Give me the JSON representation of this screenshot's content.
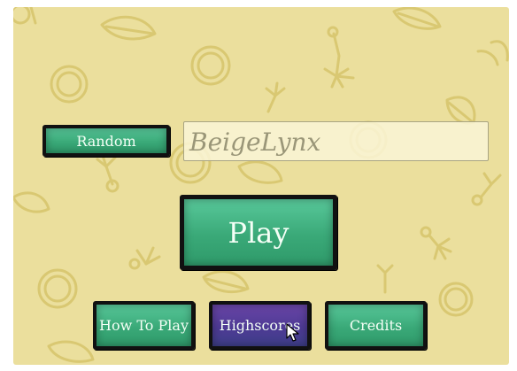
{
  "menu": {
    "random_label": "Random",
    "player_name": "BeigeLynx",
    "play_label": "Play",
    "how_to_play_label": "How To Play",
    "highscores_label": "Highscores",
    "credits_label": "Credits"
  },
  "colors": {
    "background": "#ebdf9d",
    "doodle": "#d9c872",
    "button_green": "#3aa978",
    "button_purple": "#4e3a94",
    "button_border": "#111111"
  },
  "icons": {
    "cursor": "mouse-pointer-icon",
    "background": "leaf-and-bubble-doodles"
  }
}
